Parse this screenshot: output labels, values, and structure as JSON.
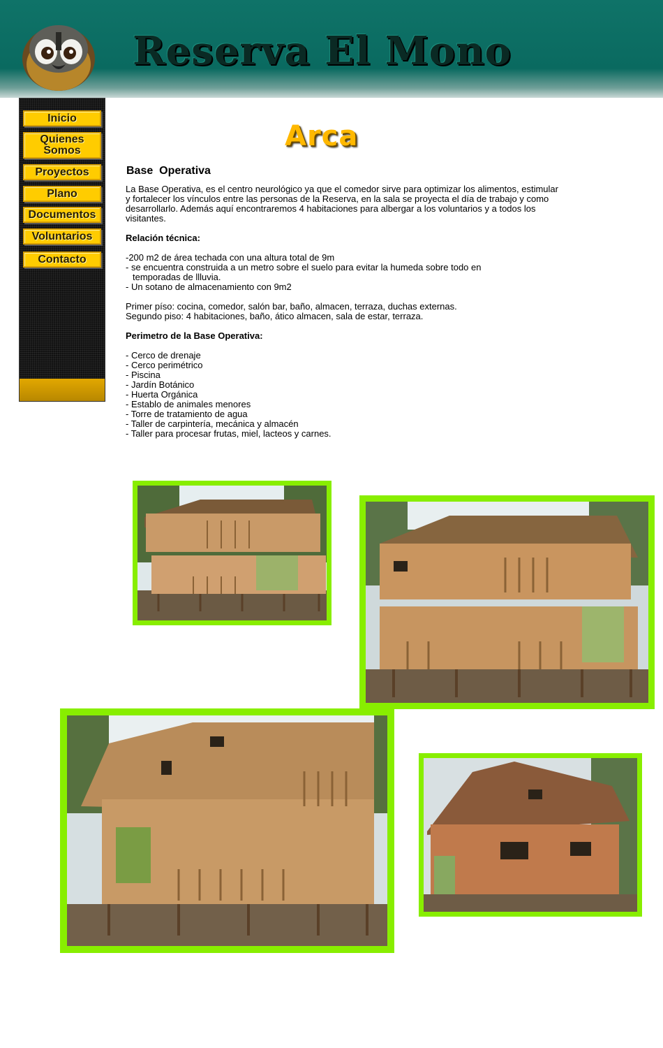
{
  "header": {
    "title": "Reserva El Mono"
  },
  "sidebar": {
    "items": [
      {
        "label": "Inicio"
      },
      {
        "label": "Quienes Somos"
      },
      {
        "label": "Proyectos"
      },
      {
        "label": "Plano"
      },
      {
        "label": "Documentos"
      },
      {
        "label": "Voluntarios"
      },
      {
        "label": "Contacto"
      }
    ]
  },
  "main": {
    "heading": "Arca",
    "section_title": "Base  Operativa",
    "intro": "La Base Operativa, es el centro neurológico ya que el comedor sirve para optimizar los alimentos, estimular y fortalecer los vínculos entre las personas de la Reserva, en la sala se proyecta el día de trabajo y como desarrollarlo. Además aquí encontraremos 4 habitaciones para albergar a los voluntarios y a todos los visitantes.",
    "technical_heading": "Relación técnica:",
    "technical_items": [
      "-200 m2 de área techada con una altura total de 9m",
      "- se encuentra construida a un metro sobre el suelo para evitar la humeda sobre todo en",
      "temporadas de llluvia.",
      "- Un sotano de almacenamiento con 9m2"
    ],
    "floors": [
      "Primer píso: cocina, comedor, salón bar, baño, almacen, terraza, duchas externas.",
      "Segundo piso: 4 habitaciones, baño, ático almacen, sala de estar, terraza."
    ],
    "perimeter_heading": "Perimetro de la Base Operativa:",
    "perimeter_items": [
      "- Cerco de drenaje",
      "- Cerco perimétrico",
      "- Piscina",
      "- Jardín Botánico",
      "- Huerta Orgánica",
      "- Establo de animales menores",
      "- Torre de tratamiento de agua",
      "- Taller de carpintería, mecánica y almacén",
      "- Taller para procesar frutas, miel, lacteos y carnes."
    ]
  },
  "colors": {
    "header_teal": "#0a6a60",
    "nav_yellow": "#ffcc00",
    "heading_gold": "#ffb800",
    "photo_frame_green": "#88ee00"
  }
}
